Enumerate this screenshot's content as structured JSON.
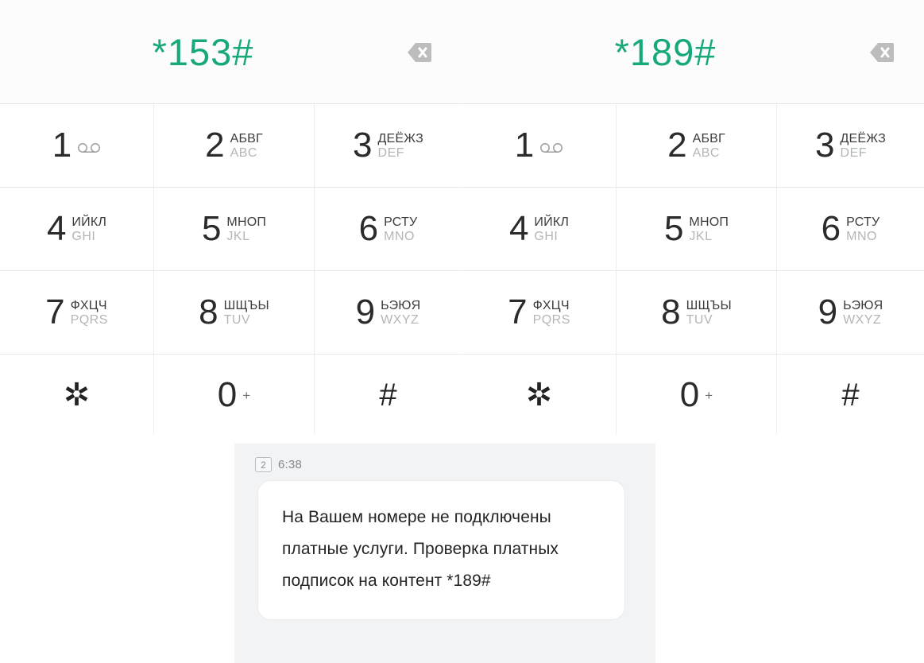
{
  "theme": {
    "accent_green": "#17a97c",
    "digit_color": "#2b2b2b",
    "letters_ru_color": "#3c3c3c",
    "letters_en_color": "#b3b6b8",
    "sms_panel_bg": "#f2f3f5",
    "bubble_bg": "#ffffff"
  },
  "panels": [
    {
      "id": "left",
      "ussd_code": "*153#",
      "backspace_icon": "backspace-delete-icon"
    },
    {
      "id": "right",
      "ussd_code": "*189#",
      "backspace_icon": "backspace-delete-icon"
    }
  ],
  "keypad": {
    "keys": [
      {
        "digit": "1",
        "ru": "",
        "en": "",
        "icon": "voicemail-icon"
      },
      {
        "digit": "2",
        "ru": "АБВГ",
        "en": "ABC",
        "icon": ""
      },
      {
        "digit": "3",
        "ru": "ДЕЁЖЗ",
        "en": "DEF",
        "icon": ""
      },
      {
        "digit": "4",
        "ru": "ИЙКЛ",
        "en": "GHI",
        "icon": ""
      },
      {
        "digit": "5",
        "ru": "МНОП",
        "en": "JKL",
        "icon": ""
      },
      {
        "digit": "6",
        "ru": "РСТУ",
        "en": "MNO",
        "icon": ""
      },
      {
        "digit": "7",
        "ru": "ФХЦЧ",
        "en": "PQRS",
        "icon": ""
      },
      {
        "digit": "8",
        "ru": "ШЩЪЫ",
        "en": "TUV",
        "icon": ""
      },
      {
        "digit": "9",
        "ru": "ЬЭЮЯ",
        "en": "WXYZ",
        "icon": ""
      },
      {
        "digit": "✲",
        "ru": "",
        "en": "",
        "icon": "asterisk-icon"
      },
      {
        "digit": "0",
        "ru": "",
        "en": "",
        "icon": "plus-sign",
        "plus": "+"
      },
      {
        "digit": "#",
        "ru": "",
        "en": "",
        "icon": "hash-icon"
      }
    ]
  },
  "sms": {
    "sim_badge": "2",
    "time": "6:38",
    "message": "На Вашем номере не подключены платные услуги. Проверка платных подписок на контент *189#"
  }
}
